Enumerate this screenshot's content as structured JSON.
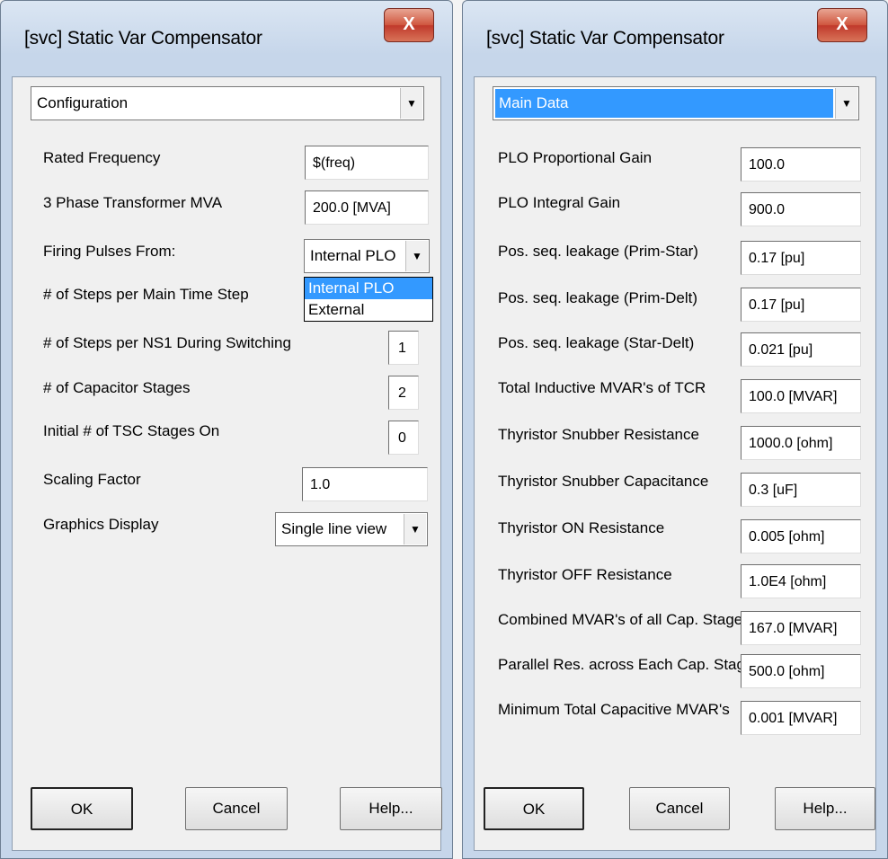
{
  "left": {
    "title": "[svc] Static Var Compensator",
    "close_label": "X",
    "section": "Configuration",
    "rows": [
      {
        "label": "Rated Frequency",
        "value": "$(freq)"
      },
      {
        "label": "3 Phase Transformer MVA",
        "value": "200.0 [MVA]"
      },
      {
        "label": "Firing Pulses From:",
        "value": "Internal PLO"
      },
      {
        "label": "# of Steps per Main Time Step",
        "value": ""
      },
      {
        "label": "# of Steps per NS1 During Switching",
        "value": "1"
      },
      {
        "label": "# of Capacitor Stages",
        "value": "2"
      },
      {
        "label": "Initial # of TSC Stages On",
        "value": "0"
      },
      {
        "label": "Scaling Factor",
        "value": "1.0"
      },
      {
        "label": "Graphics Display",
        "value": "Single line view"
      }
    ],
    "dropdown_options": [
      "Internal PLO",
      "External"
    ],
    "buttons": {
      "ok": "OK",
      "cancel": "Cancel",
      "help": "Help..."
    }
  },
  "right": {
    "title": "[svc] Static Var Compensator",
    "close_label": "X",
    "section": "Main Data",
    "rows": [
      {
        "label": "PLO Proportional Gain",
        "value": "100.0"
      },
      {
        "label": "PLO Integral Gain",
        "value": "900.0"
      },
      {
        "label": "Pos. seq. leakage (Prim-Star)",
        "value": "0.17 [pu]"
      },
      {
        "label": "Pos. seq. leakage (Prim-Delt)",
        "value": "0.17 [pu]"
      },
      {
        "label": "Pos. seq. leakage (Star-Delt)",
        "value": "0.021 [pu]"
      },
      {
        "label": "Total Inductive MVAR's of TCR",
        "value": "100.0 [MVAR]"
      },
      {
        "label": "Thyristor Snubber Resistance",
        "value": "1000.0 [ohm]"
      },
      {
        "label": "Thyristor Snubber Capacitance",
        "value": "0.3 [uF]"
      },
      {
        "label": "Thyristor ON  Resistance",
        "value": "0.005 [ohm]"
      },
      {
        "label": "Thyristor OFF Resistance",
        "value": "1.0E4 [ohm]"
      },
      {
        "label": "Combined MVAR's of all Cap. Stages",
        "value": "167.0 [MVAR]"
      },
      {
        "label": "Parallel Res. across Each Cap. Stage",
        "value": "500.0 [ohm]"
      },
      {
        "label": "Minimum Total Capacitive MVAR's",
        "value": "0.001 [MVAR]"
      }
    ],
    "buttons": {
      "ok": "OK",
      "cancel": "Cancel",
      "help": "Help..."
    }
  }
}
